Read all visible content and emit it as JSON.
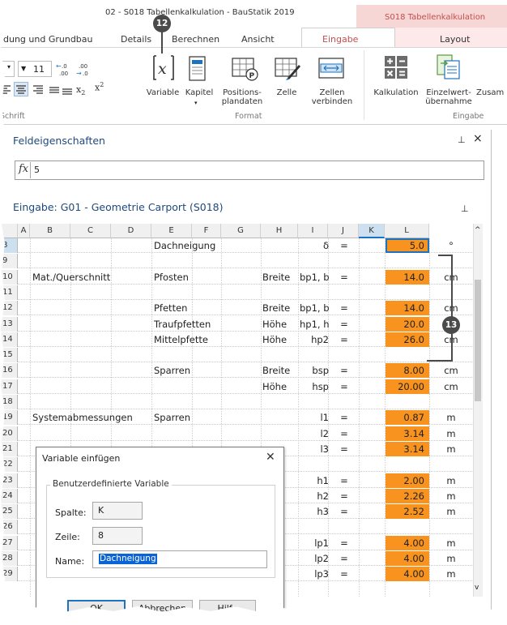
{
  "window": {
    "title": "02 - S018 Tabellenkalkulation - BauStatik 2019",
    "context_title": "S018 Tabellenkalkulation"
  },
  "tabs": {
    "items": [
      "dung und Grundbau",
      "Details",
      "Berechnen",
      "Ansicht"
    ],
    "active": "Eingabe",
    "layout": "Layout"
  },
  "ribbon": {
    "font_size": "11",
    "group_schrift": "Schrift",
    "group_format": "Format",
    "group_eingabe": "Eingabe",
    "variable": "Variable",
    "kapitel": "Kapitel",
    "positionsplandaten": "Positions-\nplandaten",
    "zelle": "Zelle",
    "zellen_verbinden": "Zellen\nverbinden",
    "kalkulation": "Kalkulation",
    "einzelwert": "Einzelwert-\nübernahme",
    "zusam": "Zusam"
  },
  "properties": {
    "title": "Feldeigenschaften",
    "fx": "fx",
    "formula_value": "5"
  },
  "sheet": {
    "title": "Eingabe: G01 - Geometrie Carport (S018)",
    "columns": [
      "A",
      "B",
      "C",
      "D",
      "E",
      "F",
      "G",
      "H",
      "I",
      "J",
      "K",
      "L"
    ],
    "selected_column": "K",
    "rows": [
      {
        "n": "8",
        "d": "Dachneigung",
        "i": "δ",
        "j": "=",
        "k": "5.0",
        "l": "°",
        "sel": true
      },
      {
        "n": "9"
      },
      {
        "n": "10",
        "a": "Mat./Querschnitt",
        "d": "Pfosten",
        "g": "Breite",
        "i": "bp1, bp",
        "j": "=",
        "k": "14.0",
        "l": "cm"
      },
      {
        "n": "11"
      },
      {
        "n": "12",
        "d": "Pfetten",
        "g": "Breite",
        "i": "bp1, bp",
        "j": "=",
        "k": "14.0",
        "l": "cm"
      },
      {
        "n": "13",
        "d": "Traufpfetten",
        "g": "Höhe",
        "i": "hp1, hp",
        "j": "=",
        "k": "20.0",
        "l": "cm"
      },
      {
        "n": "14",
        "d": "Mittelpfette",
        "g": "Höhe",
        "i": "hp2",
        "j": "=",
        "k": "26.0",
        "l": "cm"
      },
      {
        "n": "15"
      },
      {
        "n": "16",
        "d": "Sparren",
        "g": "Breite",
        "i": "bsp",
        "j": "=",
        "k": "8.00",
        "l": "cm"
      },
      {
        "n": "17",
        "g": "Höhe",
        "i": "hsp",
        "j": "=",
        "k": "20.00",
        "l": "cm"
      },
      {
        "n": "18"
      },
      {
        "n": "19",
        "a": "Systemabmessungen",
        "d": "Sparren",
        "i": "l1",
        "j": "=",
        "k": "0.87",
        "l": "m"
      },
      {
        "n": "20",
        "i": "l2",
        "j": "=",
        "k": "3.14",
        "l": "m"
      },
      {
        "n": "21",
        "i": "l3",
        "j": "=",
        "k": "3.14",
        "l": "m"
      },
      {
        "n": "22"
      },
      {
        "n": "23",
        "i": "h1",
        "j": "=",
        "k": "2.00",
        "l": "m"
      },
      {
        "n": "24",
        "i": "h2",
        "j": "=",
        "k": "2.26",
        "l": "m"
      },
      {
        "n": "25",
        "i": "h3",
        "j": "=",
        "k": "2.52",
        "l": "m"
      },
      {
        "n": "26"
      },
      {
        "n": "27",
        "i": "lp1",
        "j": "=",
        "k": "4.00",
        "l": "m"
      },
      {
        "n": "28",
        "i": "lp2",
        "j": "=",
        "k": "4.00",
        "l": "m"
      },
      {
        "n": "29",
        "i": "lp3",
        "j": "=",
        "k": "4.00",
        "l": "m"
      }
    ]
  },
  "dialog": {
    "title": "Variable einfügen",
    "group": "Benutzerdefinierte Variable",
    "spalte_label": "Spalte:",
    "spalte_value": "K",
    "zeile_label": "Zeile:",
    "zeile_value": "8",
    "name_label": "Name:",
    "name_value": "Dachneigung",
    "ok": "OK",
    "cancel": "Abbrechen",
    "help": "Hilfe"
  },
  "markers": {
    "m12": "12",
    "m13": "13"
  },
  "colors": {
    "accent": "#c0504d",
    "input_cell": "#f7931e",
    "selection": "#1e73be",
    "heading": "#1f497d"
  }
}
